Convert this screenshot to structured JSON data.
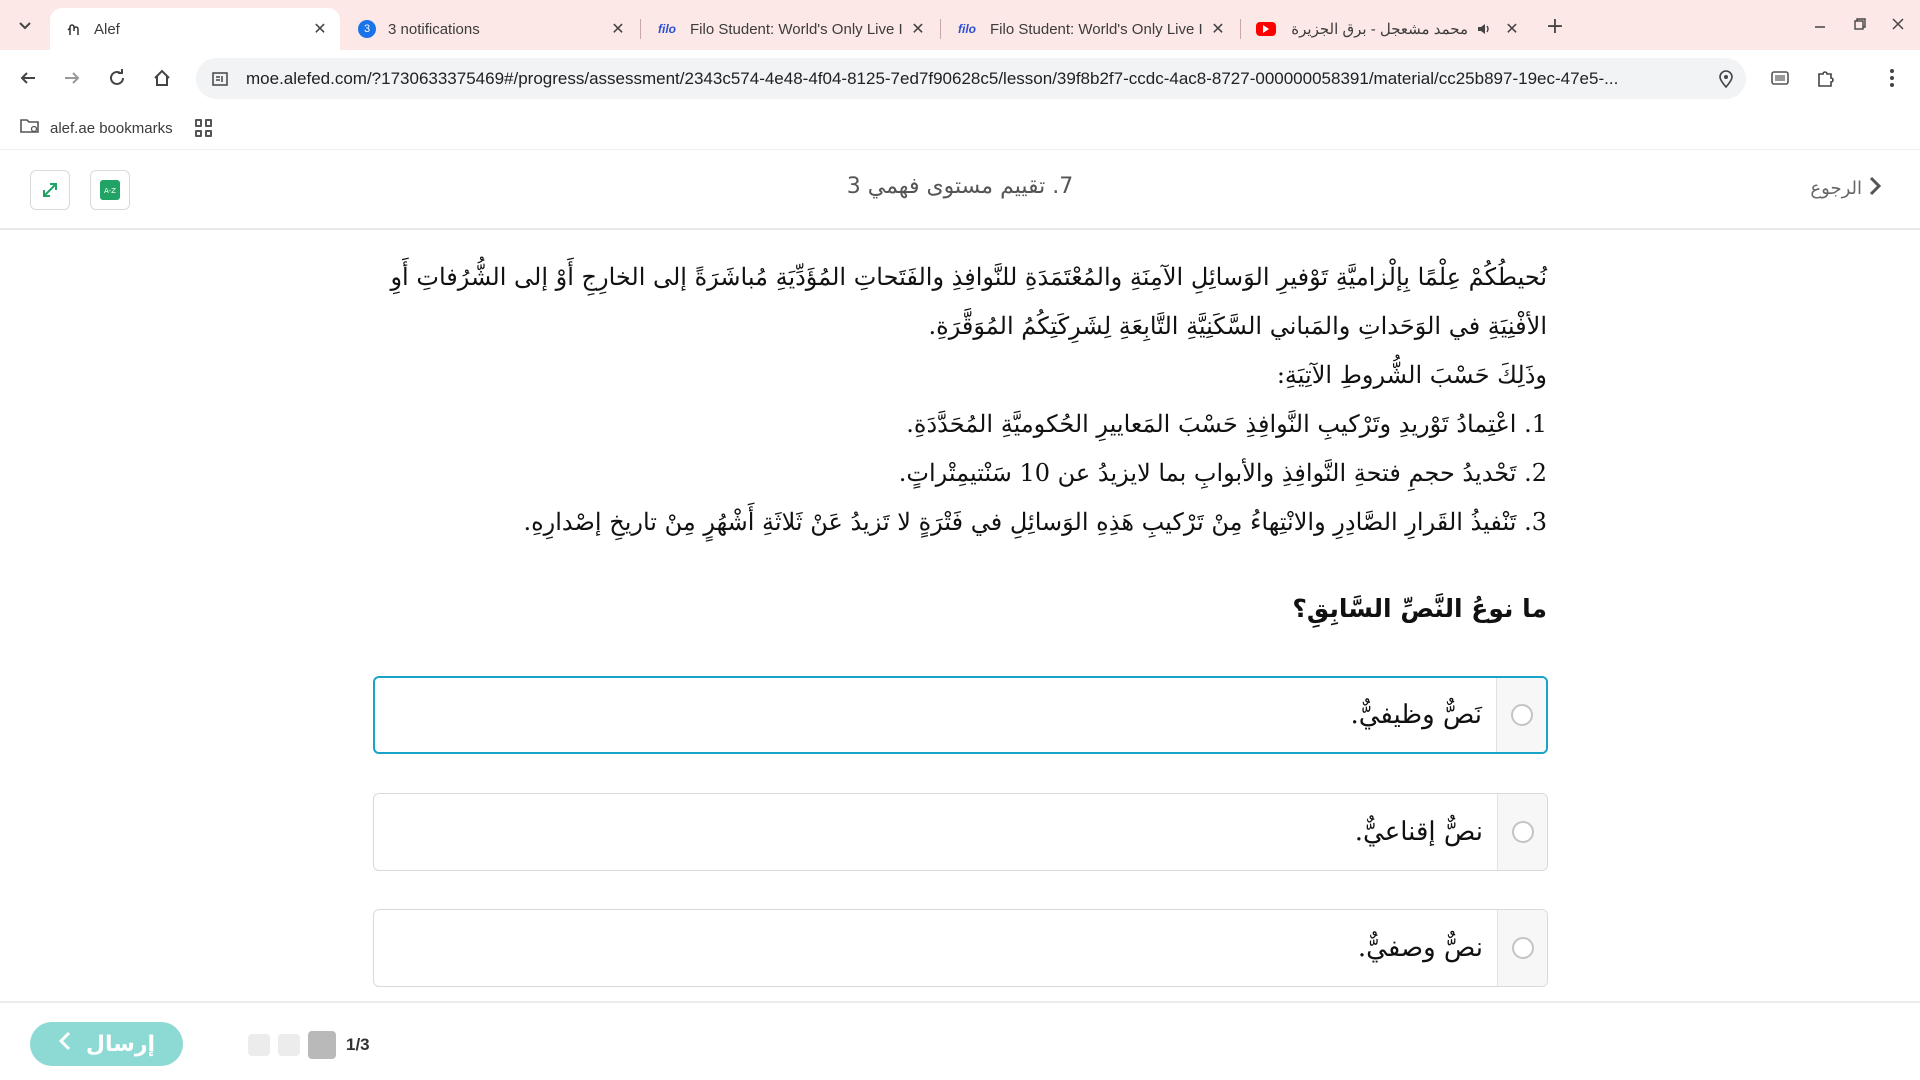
{
  "browser": {
    "tabs": [
      {
        "title": "Alef",
        "icon": "alef-icon",
        "active": true
      },
      {
        "title": "3 notifications",
        "icon": "notification-badge-icon",
        "badge": "3",
        "active": false
      },
      {
        "title": "Filo Student: World's Only Live I",
        "icon": "filo-icon",
        "favtext": "filo",
        "active": false
      },
      {
        "title": "Filo Student: World's Only Live I",
        "icon": "filo-icon",
        "favtext": "filo",
        "active": false
      },
      {
        "title": "محمد مشعجل - برق الجزيرة",
        "icon": "youtube-icon",
        "active": false,
        "audio": true
      }
    ],
    "url": "moe.alefed.com/?1730633375469#/progress/assessment/2343c574-4e48-4f04-8125-7ed7f90628c5/lesson/39f8b2f7-ccdc-4ac8-8727-000000058391/material/cc25b897-19ec-47e5-...",
    "bookmarks": [
      {
        "label": "alef.ae bookmarks",
        "icon": "folder-icon"
      }
    ]
  },
  "header": {
    "back_label": "الرجوع",
    "title": "7. تقييم مستوى فهمي 3"
  },
  "passage": {
    "lines": [
      "نُحيطُكُمْ عِلْمًا بِإلْزاميَّةِ تَوْفيرِ الوَسائِلِ الآمِنَةِ والمُعْتَمَدَةِ للنَّوافِذِ والفَتَحاتِ المُؤَدِّيَةِ مُباشَرَةً إلى الخارِجِ أَوْ إلى الشُّرُفاتِ أَوِ الأفْنِيَةِ في الوَحَداتِ والمَباني السَّكَنِيَّةِ التَّابِعَةِ لِشَرِكَتِكُمُ المُوَقَّرَةِ.",
      "وذَلِكَ حَسْبَ الشُّروطِ الآتِيَةِ:",
      "1. اعْتِمادُ تَوْريدِ وتَرْكيبِ النَّوافِذِ حَسْبَ المَعاييرِ الحُكوميَّةِ المُحَدَّدَةِ.",
      "2. تَحْديدُ حجمِ فتحةِ النَّوافِذِ والأبوابِ بما لايزيدُ عن 10 سَنْتيمِتْراتٍ.",
      "3. تَنْفيذُ القَرارِ الصَّادِرِ والانْتِهاءُ مِنْ تَرْكيبِ هَذِهِ الوَسائِلِ في فَتْرَةٍ لا تَزيدُ عَنْ ثَلاثَةِ أَشْهُرٍ مِنْ تاريخِ إصْدارِهِ."
    ]
  },
  "question": {
    "text": "ما نوعُ النَّصِّ السَّابِقِ؟",
    "options": [
      {
        "label": "نَصٌّ وظيفيٌّ.",
        "selected": true
      },
      {
        "label": "نصٌّ إقناعيٌّ.",
        "selected": false
      },
      {
        "label": "نصٌّ وصفيٌّ.",
        "selected": false
      }
    ]
  },
  "footer": {
    "send_label": "إرسال",
    "pager_label": "1/3",
    "current_page": 1,
    "total_pages": 3
  },
  "colors": {
    "tabstrip": "#fce8e6",
    "selected_border": "#1aa3c9",
    "send_button": "#8dd9d3",
    "icon_green": "#21a366"
  }
}
